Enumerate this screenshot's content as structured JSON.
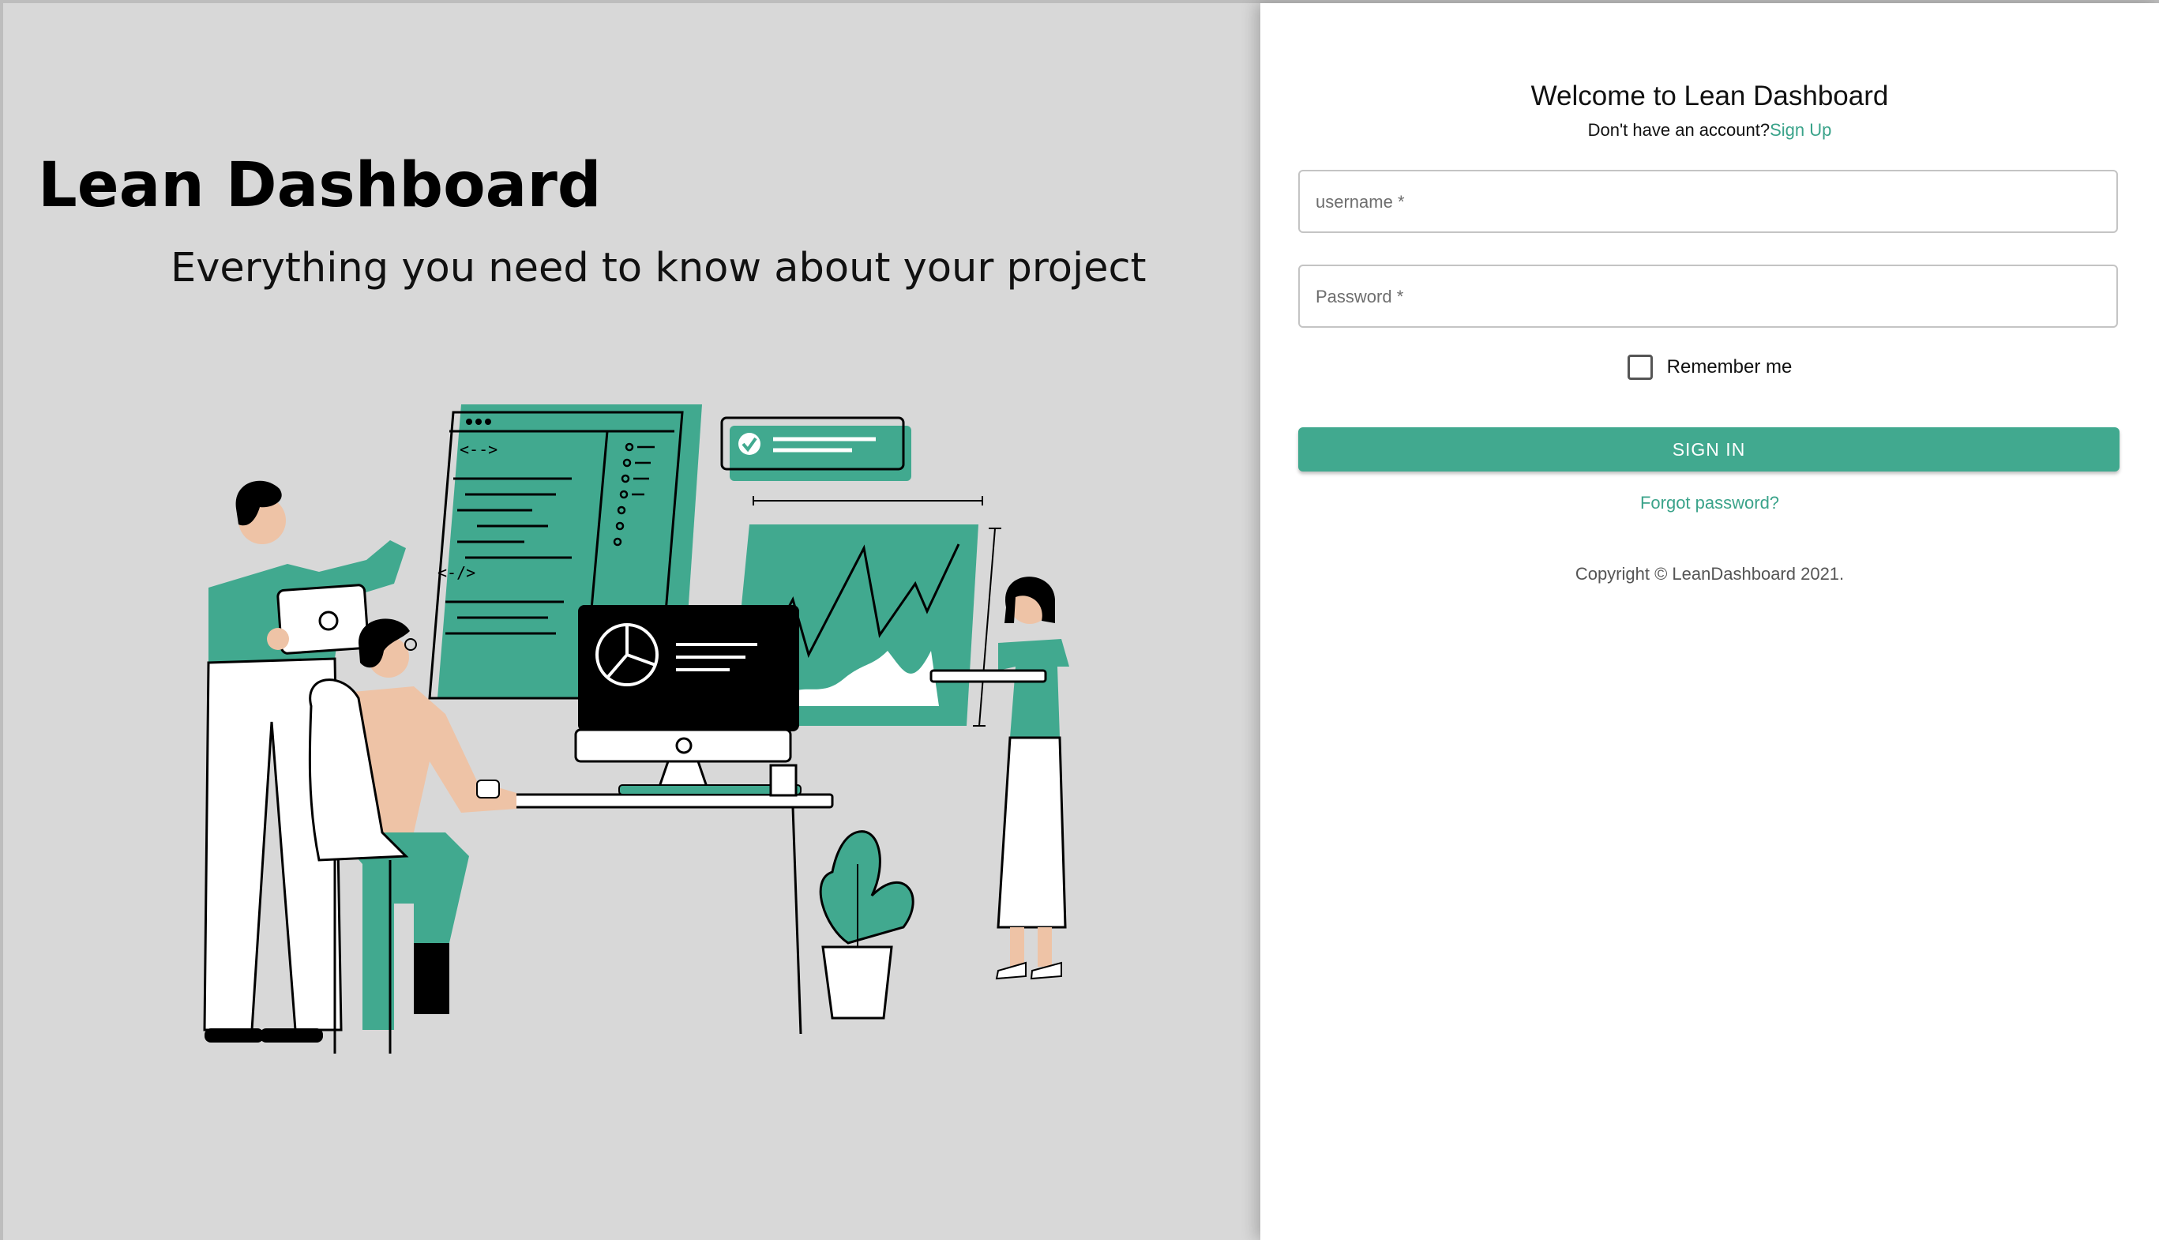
{
  "brand": {
    "title": "Lean Dashboard",
    "subtitle": "Everything you need to know about your project"
  },
  "illustration": {
    "name": "team-working-on-dashboard-illustration",
    "accent_color": "#41a98f",
    "background_color": "#d8d8d8"
  },
  "login": {
    "title": "Welcome to Lean Dashboard",
    "signup_prompt": "Don't have an account?",
    "signup_link": "Sign Up",
    "username_placeholder": "username *",
    "password_placeholder": "Password *",
    "remember_label": "Remember me",
    "remember_checked": false,
    "signin_label": "SIGN IN",
    "forgot_label": "Forgot password?",
    "copyright": "Copyright © LeanDashboard 2021."
  },
  "colors": {
    "accent": "#41a98f",
    "link": "#3aa38a"
  }
}
